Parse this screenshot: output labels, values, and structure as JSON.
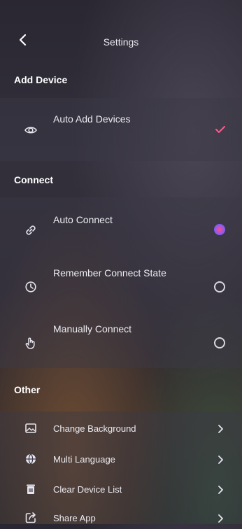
{
  "header": {
    "title": "Settings",
    "back_icon": "chevron-left-icon"
  },
  "sections": {
    "add_device": {
      "title": "Add Device"
    },
    "connect": {
      "title": "Connect"
    },
    "other": {
      "title": "Other"
    }
  },
  "add_device_items": [
    {
      "label": "Auto Add Devices",
      "icon": "eye-icon",
      "control": "checkmark",
      "checked": true
    }
  ],
  "connect_items": [
    {
      "label": "Auto Connect",
      "icon": "link-icon",
      "control": "radio",
      "checked": true
    },
    {
      "label": "Remember Connect State",
      "icon": "clock-icon",
      "control": "radio",
      "checked": false
    },
    {
      "label": "Manually Connect",
      "icon": "hand-pointer-icon",
      "control": "radio",
      "checked": false
    }
  ],
  "other_items": [
    {
      "label": "Change Background",
      "icon": "image-icon"
    },
    {
      "label": "Multi Language",
      "icon": "globe-icon"
    },
    {
      "label": "Clear Device List",
      "icon": "trash-icon"
    },
    {
      "label": "Share App",
      "icon": "share-icon"
    }
  ],
  "colors": {
    "accent_check": "#ff5a8c",
    "radio_gradient_start": "#ff4d8a",
    "radio_gradient_end": "#7a5cff"
  }
}
